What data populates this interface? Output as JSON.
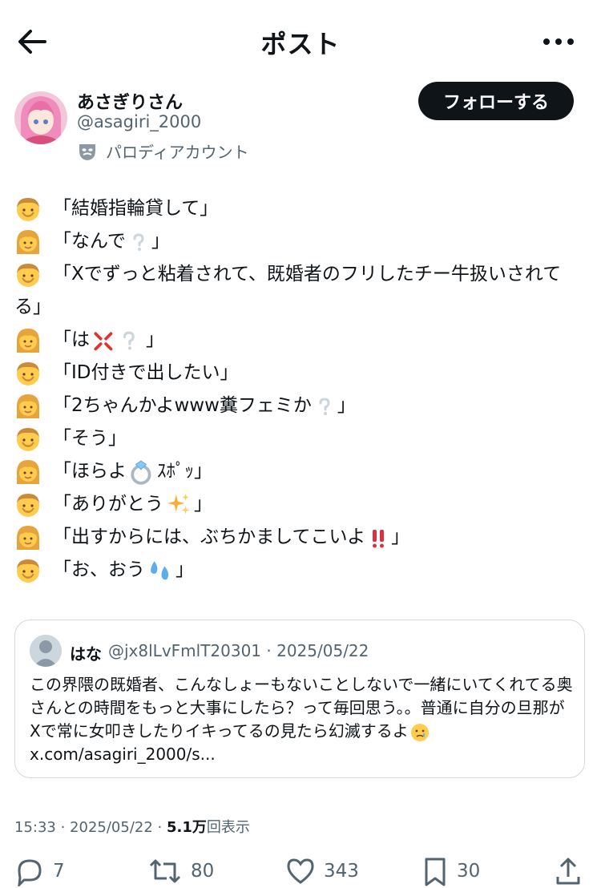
{
  "header": {
    "title": "ポスト"
  },
  "user": {
    "name": "あさぎりさん",
    "handle": "@asagiri_2000",
    "badge": "パロディアカウント",
    "follow_label": "フォローする"
  },
  "tweet": {
    "lines": [
      {
        "speaker": "man",
        "text": "「結婚指輪貸して」"
      },
      {
        "speaker": "woman",
        "text": "「なんで",
        "suffix": "」",
        "emoji": "white-question"
      },
      {
        "speaker": "man",
        "text": "「Xでずっと粘着されて、既婚者のフリしたチー牛扱いされてる」"
      },
      {
        "speaker": "woman",
        "text": "「は",
        "suffix": "」",
        "emoji": "anger-question"
      },
      {
        "speaker": "man",
        "text": "「ID付きで出したい」"
      },
      {
        "speaker": "woman",
        "text": "「2ちゃんかよwww糞フェミか",
        "suffix": "」",
        "emoji": "white-question"
      },
      {
        "speaker": "man",
        "text": "「そう」"
      },
      {
        "speaker": "woman",
        "text": "「ほらよ",
        "suffix": "ｽﾎﾟｯ」",
        "emoji": "ring"
      },
      {
        "speaker": "man",
        "text": "「ありがとう",
        "suffix": "」",
        "emoji": "sparkles"
      },
      {
        "speaker": "woman",
        "text": "「出すからには、ぶちかましてこいよ",
        "suffix": "」",
        "emoji": "double-exclamation"
      },
      {
        "speaker": "man",
        "text": "「お、おう",
        "suffix": "」",
        "emoji": "sweat-drops"
      }
    ]
  },
  "quote": {
    "name": "はな",
    "meta": "@jx8lLvFmlT20301 · 2025/05/22",
    "text": "この界隈の既婚者、こんなしょーもないことしないで一緒にいてくれてる奥さんとの時間をもっと大事にしたら？って毎回思う。。普通に自分の旦那がXで常に女叩きしたりイキってるの見たら幻滅するよ",
    "link": "x.com/asagiri_2000/s..."
  },
  "stats": {
    "time": "15:33 · 2025/05/22 · ",
    "views_count": "5.1万",
    "views_label": "回表示"
  },
  "actions": {
    "replies": "7",
    "reposts": "80",
    "likes": "343",
    "bookmarks": "30"
  },
  "colors": {
    "text": "#0f1419",
    "muted": "#536471",
    "border": "#cfd9de"
  }
}
